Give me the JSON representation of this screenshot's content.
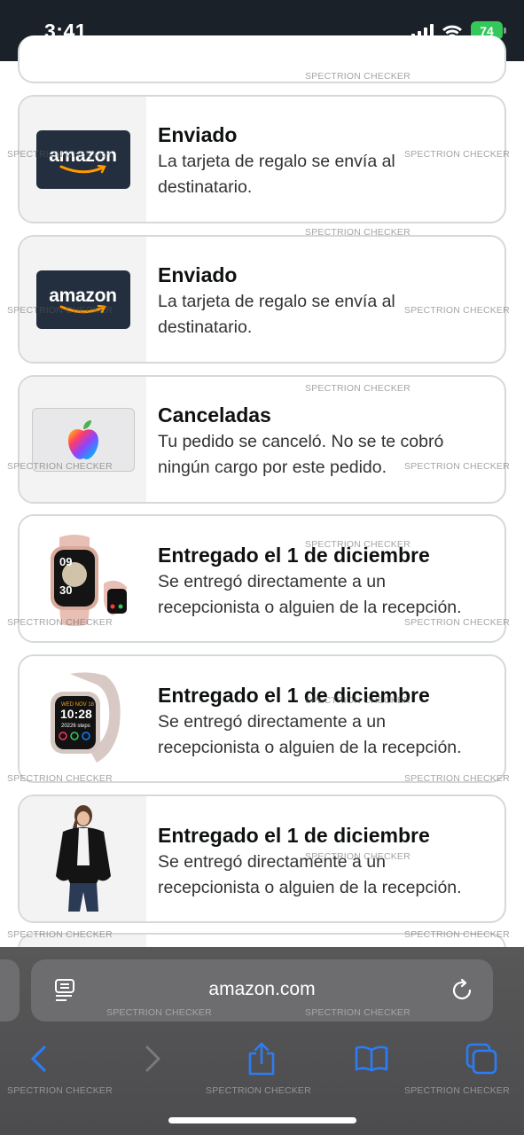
{
  "status_bar": {
    "time": "3:41",
    "battery": "74"
  },
  "orders": [
    {
      "title": "Enviado",
      "description_line1": "La tarjeta de regalo se envía al",
      "description_line2": "destinatario.",
      "thumbnail": "amazon-gift-card",
      "logo_text": "amazon"
    },
    {
      "title": "Enviado",
      "description_line1": "La tarjeta de regalo se envía al",
      "description_line2": "destinatario.",
      "thumbnail": "amazon-gift-card",
      "logo_text": "amazon"
    },
    {
      "title": "Canceladas",
      "description_line1": "Tu pedido se canceló. No se te cobró",
      "description_line2": "ningún cargo por este pedido.",
      "thumbnail": "apple-gift-card"
    },
    {
      "title": "Entregado el 1 de diciembre",
      "description_line1": "Se entregó directamente a un",
      "description_line2": "recepcionista o alguien de la recepción.",
      "thumbnail": "pink-smartwatch"
    },
    {
      "title": "Entregado el 1 de diciembre",
      "description_line1": "Se entregó directamente a un",
      "description_line2": "recepcionista o alguien de la recepción.",
      "thumbnail": "rose-smartwatch"
    },
    {
      "title": "Entregado el 1 de diciembre",
      "description_line1": "Se entregó directamente a un",
      "description_line2": "recepcionista o alguien de la recepción.",
      "thumbnail": "black-cardigan"
    }
  ],
  "browser": {
    "url": "amazon.com"
  },
  "toolbar": {
    "icons": [
      "back-icon",
      "forward-icon",
      "share-icon",
      "bookmarks-icon",
      "tabs-icon"
    ]
  },
  "watermark": "SPECTRION CHECKER",
  "colors": {
    "status_bar": "#1b2129",
    "card_border": "#d5d9d9",
    "amazon_dark": "#232f3e",
    "amazon_orange": "#ff9900",
    "ios_blue": "#2b7cf6",
    "battery_green": "#34c759"
  }
}
